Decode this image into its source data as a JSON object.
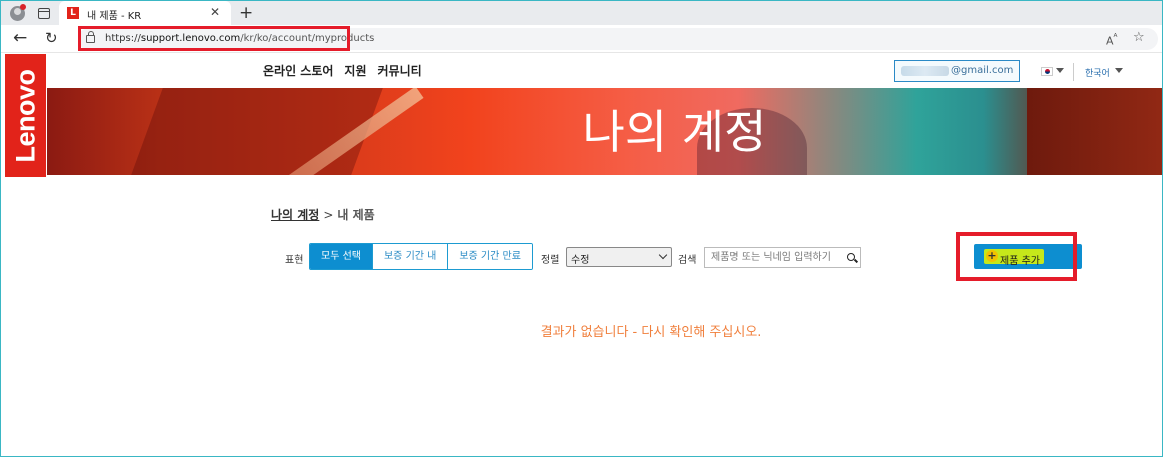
{
  "browser": {
    "tab_title": "내 제품 - KR",
    "tab_favicon": "L",
    "url_scheme": "https://",
    "url_host": "support.lenovo.com",
    "url_path": "/kr/ko/account/myproducts"
  },
  "site": {
    "logo": "Lenovo",
    "nav": [
      "온라인 스토어",
      "지원",
      "커뮤니티"
    ],
    "user_email": "@gmail.com",
    "language": "한국어",
    "banner_title": "나의 계정",
    "accent_color": "#0d8ed0",
    "brand_color": "#e2231a"
  },
  "breadcrumb": {
    "parent": "나의 계정",
    "separator": ">",
    "current": "내 제품"
  },
  "filters": {
    "label": "표현",
    "options": [
      "모두 선택",
      "보증 기간 내",
      "보증 기간 만료"
    ],
    "selected": "모두 선택",
    "sort_label": "정렬",
    "sort_value": "수정",
    "search_label": "검색",
    "search_placeholder": "제품명 또는 닉네임 입력하기"
  },
  "actions": {
    "add_product": "제품 추가",
    "add_icon": "plus-circle-icon"
  },
  "results": {
    "empty_message": "결과가 없습니다 - 다시 확인해 주십시오."
  }
}
